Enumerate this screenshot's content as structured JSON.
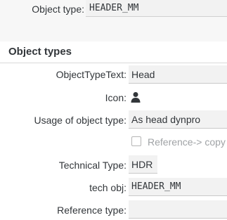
{
  "header": {
    "object_type_label": "Object type:",
    "object_type_value": "HEADER_MM"
  },
  "section": {
    "title": "Object types"
  },
  "form": {
    "object_type_text_label": "ObjectTypeText:",
    "object_type_text_value": "Head",
    "icon_label": "Icon:",
    "icon_name": "person-icon",
    "usage_label": "Usage of object type:",
    "usage_value": "As head dynpro",
    "reference_copy_label": "Reference-> copy",
    "reference_copy_checked": false,
    "technical_type_label": "Technical Type:",
    "technical_type_value": "HDR",
    "tech_obj_label": "tech obj:",
    "tech_obj_value": "HEADER_MM",
    "reference_type_label": "Reference type:",
    "reference_type_value": ""
  },
  "colors": {
    "text": "#32363a",
    "field_bg": "#f2f2f2",
    "disabled_text": "#a0a3a6"
  }
}
